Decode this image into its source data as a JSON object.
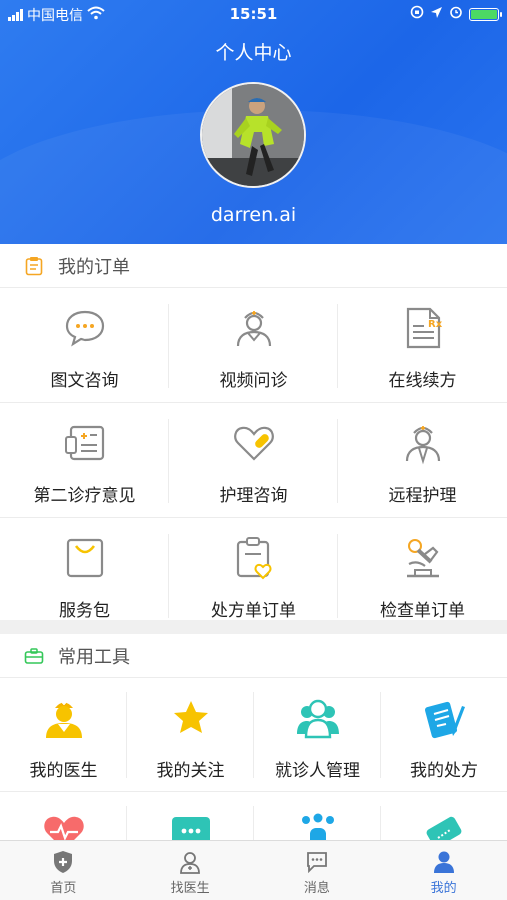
{
  "status_bar": {
    "carrier": "中国电信",
    "time": "15:51"
  },
  "header": {
    "title": "个人中心",
    "username": "darren.ai"
  },
  "orders": {
    "title": "我的订单",
    "items": [
      {
        "label": "图文咨询",
        "icon": "chat-bubble-icon"
      },
      {
        "label": "视频问诊",
        "icon": "doctor-icon"
      },
      {
        "label": "在线续方",
        "icon": "prescription-rx-icon"
      },
      {
        "label": "第二诊疗意见",
        "icon": "medical-card-icon"
      },
      {
        "label": "护理咨询",
        "icon": "heart-bandage-icon"
      },
      {
        "label": "远程护理",
        "icon": "nurse-icon"
      },
      {
        "label": "服务包",
        "icon": "shopping-bag-icon"
      },
      {
        "label": "处方单订单",
        "icon": "clipboard-heart-icon"
      },
      {
        "label": "检查单订单",
        "icon": "microscope-icon"
      }
    ]
  },
  "tools": {
    "title": "常用工具",
    "items": [
      {
        "label": "我的医生",
        "icon": "doctor-avatar-icon"
      },
      {
        "label": "我的关注",
        "icon": "star-icon"
      },
      {
        "label": "就诊人管理",
        "icon": "patients-icon"
      },
      {
        "label": "我的处方",
        "icon": "prescription-pen-icon"
      }
    ]
  },
  "tabbar": {
    "items": [
      {
        "label": "首页",
        "active": false
      },
      {
        "label": "找医生",
        "active": false
      },
      {
        "label": "消息",
        "active": false
      },
      {
        "label": "我的",
        "active": true
      }
    ]
  },
  "colors": {
    "header_blue": "#2370ec",
    "active_tab": "#3a74d8",
    "order_icon": "#8a8a8a",
    "accent_yellow": "#f7c300",
    "tools_icon": "#34c759"
  }
}
